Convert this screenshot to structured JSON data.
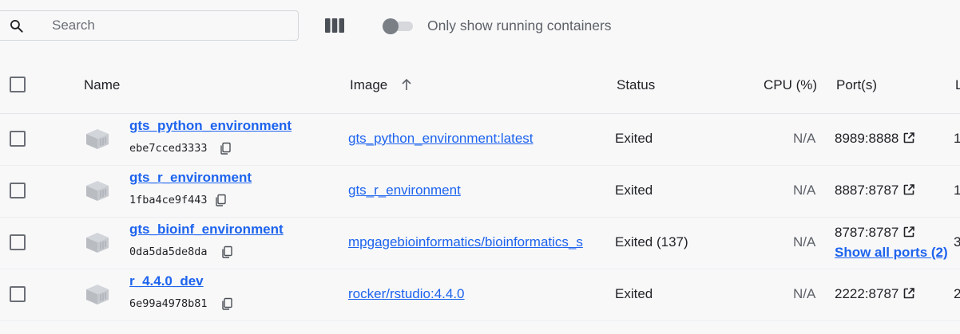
{
  "search": {
    "placeholder": "Search"
  },
  "toggle": {
    "label": "Only show running containers",
    "on": false
  },
  "headers": {
    "name": "Name",
    "image": "Image",
    "status": "Status",
    "cpu": "CPU (%)",
    "ports": "Port(s)",
    "last": "L"
  },
  "rows": [
    {
      "name": "gts_python_environment",
      "id": "ebe7cced3333",
      "image": "gts_python_environment:latest",
      "status": "Exited",
      "cpu": "N/A",
      "port": "8989:8888",
      "last": "1"
    },
    {
      "name": "gts_r_environment",
      "id": "1fba4ce9f443",
      "image": "gts_r_environment",
      "status": "Exited",
      "cpu": "N/A",
      "port": "8887:8787",
      "last": "1"
    },
    {
      "name": "gts_bioinf_environment",
      "id": "0da5da5de8da",
      "image": "mpgagebioinformatics/bioinformatics_s",
      "status": "Exited (137)",
      "cpu": "N/A",
      "port": "8787:8787",
      "show_all_ports": "Show all ports (2)",
      "last": "3"
    },
    {
      "name": "r_4.4.0_dev",
      "id": "6e99a4978b81",
      "image": "rocker/rstudio:4.4.0",
      "status": "Exited",
      "cpu": "N/A",
      "port": "2222:8787",
      "last": "2"
    }
  ],
  "colors": {
    "link": "#1d63ed",
    "text": "#1f2125",
    "muted": "#5d6168",
    "background": "#f8f8f9"
  }
}
